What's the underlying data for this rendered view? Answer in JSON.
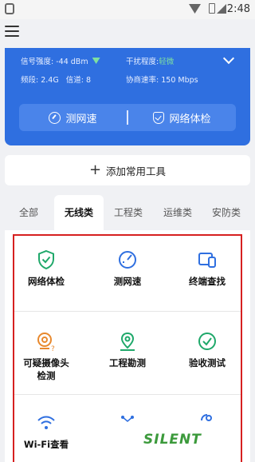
{
  "status_bar": {
    "time": "2:48"
  },
  "network": {
    "signal_label": "信号强度:",
    "signal_value": "-44 dBm",
    "interference_label": "干扰程度:",
    "interference_value": "轻微",
    "band_label": "频段:",
    "band_value": "2.4G",
    "channel_label": "信道:",
    "channel_value": "8",
    "rate_label": "协商速率:",
    "rate_value": "150 Mbps"
  },
  "actions": {
    "speed_test": "测网速",
    "network_check": "网络体检"
  },
  "add_tool": {
    "label": "添加常用工具"
  },
  "tabs": [
    "全部",
    "无线类",
    "工程类",
    "运维类",
    "安防类"
  ],
  "active_tab": "无线类",
  "tools": [
    {
      "label": "网络体检",
      "icon": "shield-check-icon"
    },
    {
      "label": "测网速",
      "icon": "speedometer-icon"
    },
    {
      "label": "终端查找",
      "icon": "devices-icon"
    },
    {
      "label_line1": "可疑摄像头",
      "label_line2": "检测",
      "icon": "camera-alert-icon"
    },
    {
      "label": "工程勘测",
      "icon": "map-pin-icon"
    },
    {
      "label": "验收测试",
      "icon": "check-circle-icon"
    },
    {
      "label": "Wi-Fi查看",
      "icon": "wifi-icon"
    }
  ],
  "watermark": {
    "text": "SILENT"
  },
  "colors": {
    "primary": "#2f6fe0",
    "accent_green": "#1fa86a",
    "highlight": "#d62020",
    "tool_orange": "#e8892e"
  }
}
